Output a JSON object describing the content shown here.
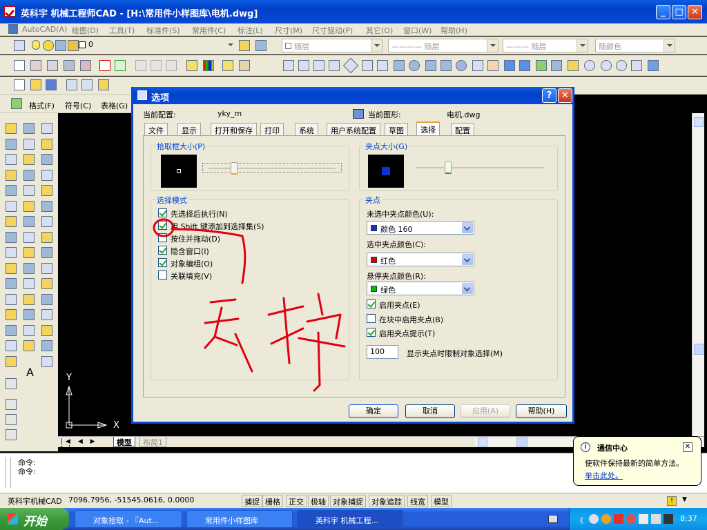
{
  "window": {
    "title": "英科宇 机械工程师CAD - [H:\\常用件小样图库\\电机.dwg]",
    "buttons": [
      "_",
      "□",
      "✕"
    ]
  },
  "menu": [
    "AutoCAD(A)",
    "绘图(D)",
    "工具(T)",
    "标准件(S)",
    "常用件(C)",
    "标注(L)",
    "尺寸(M)",
    "尺寸驱动(P)",
    "其它(O)",
    "窗口(W)",
    "帮助(H)"
  ],
  "layer_toolbar": {
    "layer_value": "0",
    "color_combo": "随层",
    "linetype_combo": "———— 随层",
    "lineweight_combo": "——— 随层",
    "plotstyle_combo": "随颜色"
  },
  "left_toolbar": {
    "labels": [
      "格式(F)",
      "符号(C)",
      "表格(G)"
    ],
    "text_tool": "A"
  },
  "dialog": {
    "title": "选项",
    "help_btn": "?",
    "close_btn": "✕",
    "current_profile_label": "当前配置:",
    "current_profile_value": "yky_m",
    "current_drawing_label": "当前图形:",
    "current_drawing_value": "电机.dwg",
    "tabs": [
      "文件",
      "显示",
      "打开和保存",
      "打印",
      "系统",
      "用户系统配置",
      "草图",
      "选择",
      "配置"
    ],
    "active_tab": "选择",
    "pickbox": {
      "label": "拾取框大小(P)",
      "slider_level": 0.2
    },
    "grip_size": {
      "label": "夹点大小(G)",
      "slider_level": 0.25
    },
    "selection_modes": {
      "label": "选择模式",
      "items": [
        {
          "label": "先选择后执行(N)",
          "checked": true
        },
        {
          "label": "用 Shift 键添加到选择集(S)",
          "checked": true
        },
        {
          "label": "按住并拖动(D)",
          "checked": false
        },
        {
          "label": "隐含窗口(I)",
          "checked": true
        },
        {
          "label": "对象编组(O)",
          "checked": true
        },
        {
          "label": "关联填充(V)",
          "checked": false
        }
      ]
    },
    "grips": {
      "label": "夹点",
      "unselected_label": "未选中夹点颜色(U):",
      "unselected_value": "颜色 160",
      "unselected_color": "#1030d8",
      "selected_label": "选中夹点颜色(C):",
      "selected_value": "红色",
      "selected_color": "#e00000",
      "hover_label": "悬停夹点颜色(R):",
      "hover_value": "绿色",
      "hover_color": "#00c000",
      "checks": [
        {
          "label": "启用夹点(E)",
          "checked": true
        },
        {
          "label": "在块中启用夹点(B)",
          "checked": false
        },
        {
          "label": "启用夹点提示(T)",
          "checked": true
        }
      ],
      "limit_value": "100",
      "limit_label": "显示夹点时限制对象选择(M)"
    },
    "buttons": {
      "ok": "确定",
      "cancel": "取消",
      "apply": "应用(A)",
      "help": "帮助(H)"
    },
    "annotation_text": "去掉",
    "annotation_color": "#e00010"
  },
  "canvas": {
    "ucs_x": "X",
    "ucs_y": "Y",
    "layout_tabs": [
      "模型",
      "布局1"
    ]
  },
  "command": {
    "lines": [
      "命令:",
      "命令:"
    ]
  },
  "status": {
    "app": "英科宇机械CAD",
    "coords": "7096.7956, -51545.0616, 0.0000",
    "toggles": [
      "捕捉",
      "栅格",
      "正交",
      "极轴",
      "对象捕捉",
      "对象追踪",
      "线宽",
      "模型"
    ]
  },
  "balloon": {
    "title": "通信中心",
    "body": "使软件保持最新的简单方法。",
    "link": "单击此处。"
  },
  "taskbar": {
    "start": "开始",
    "tasks": [
      "对象拾取 - 『Aut...",
      "常用件小样图库",
      "英科宇 机械工程..."
    ],
    "clock": "8:37"
  }
}
